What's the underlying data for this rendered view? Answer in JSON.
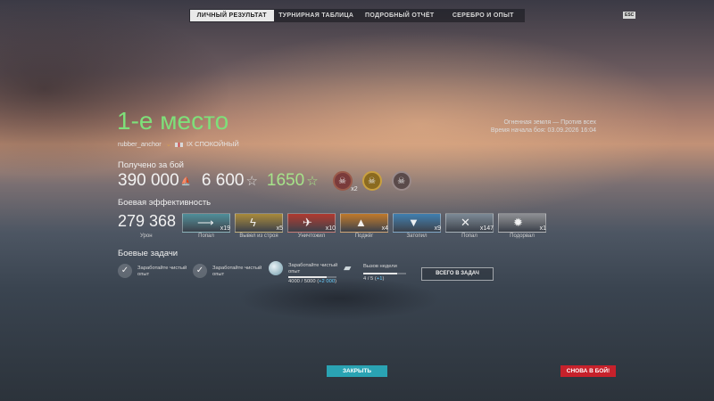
{
  "tabs": [
    "ЛИЧНЫЙ РЕЗУЛЬТАТ",
    "ТУРНИРНАЯ ТАБЛИЦА",
    "ПОДРОБНЫЙ ОТЧЁТ",
    "СЕРЕБРО И ОПЫТ"
  ],
  "active_tab": 0,
  "esc_label": "ESC",
  "result": {
    "place": "1-е место",
    "player": "rubber_anchor",
    "ship": "IX СПОКОЙНЫЙ"
  },
  "battle_info": {
    "mode": "Огненная земля — Против всех",
    "start_time": "Время начала боя: 03.09.2026 16:04"
  },
  "earned": {
    "title": "Получено за бой",
    "credits": "390 000",
    "xp": "6 600",
    "free_xp": "1650",
    "achievements": [
      {
        "icon": "skull-achievement-icon",
        "count": "x2"
      },
      {
        "icon": "gold-skull-achievement-icon",
        "count": ""
      },
      {
        "icon": "skull-achievement-icon",
        "count": ""
      }
    ]
  },
  "efficiency": {
    "title": "Боевая эффективность",
    "damage": "279 368",
    "damage_label": "Урон",
    "ribbons": [
      {
        "label": "Попал",
        "count": "x19",
        "color": "#4f8f9a",
        "icon": "torpedo-hit-icon"
      },
      {
        "label": "Вывел из строя",
        "count": "x5",
        "color": "#a98a3a",
        "icon": "incapacitate-icon"
      },
      {
        "label": "Уничтожил",
        "count": "x10",
        "color": "#b0392f",
        "icon": "destroyed-icon"
      },
      {
        "label": "Поджёг",
        "count": "x4",
        "color": "#c0792a",
        "icon": "fire-icon"
      },
      {
        "label": "Затопил",
        "count": "x9",
        "color": "#3f7fb0",
        "icon": "flooding-icon"
      },
      {
        "label": "Попал",
        "count": "x147",
        "color": "#7c8a96",
        "icon": "shell-hit-icon"
      },
      {
        "label": "Подорвал",
        "count": "x1",
        "color": "#8e9094",
        "icon": "detonation-icon"
      }
    ]
  },
  "tasks": {
    "title": "Боевые задачи",
    "items": [
      {
        "text": "Заработайте чистый опыт"
      },
      {
        "text": "Заработайте чистый опыт"
      },
      {
        "text": "Заработайте чистый опыт",
        "progress_text": "4000 / 5000 (",
        "progress_plus": "+2 000",
        "progress_close": ")",
        "progress": 0.8
      },
      {
        "text": "Вызов недели",
        "progress_text": "4 / 5 (",
        "progress_plus": "+1",
        "progress_close": ")",
        "progress": 0.8
      }
    ],
    "all_tasks_label": "ВСЕГО В ЗАДАЧ"
  },
  "buttons": {
    "close": "ЗАКРЫТЬ",
    "to_battle": "СНОВА В БОЙ!"
  }
}
